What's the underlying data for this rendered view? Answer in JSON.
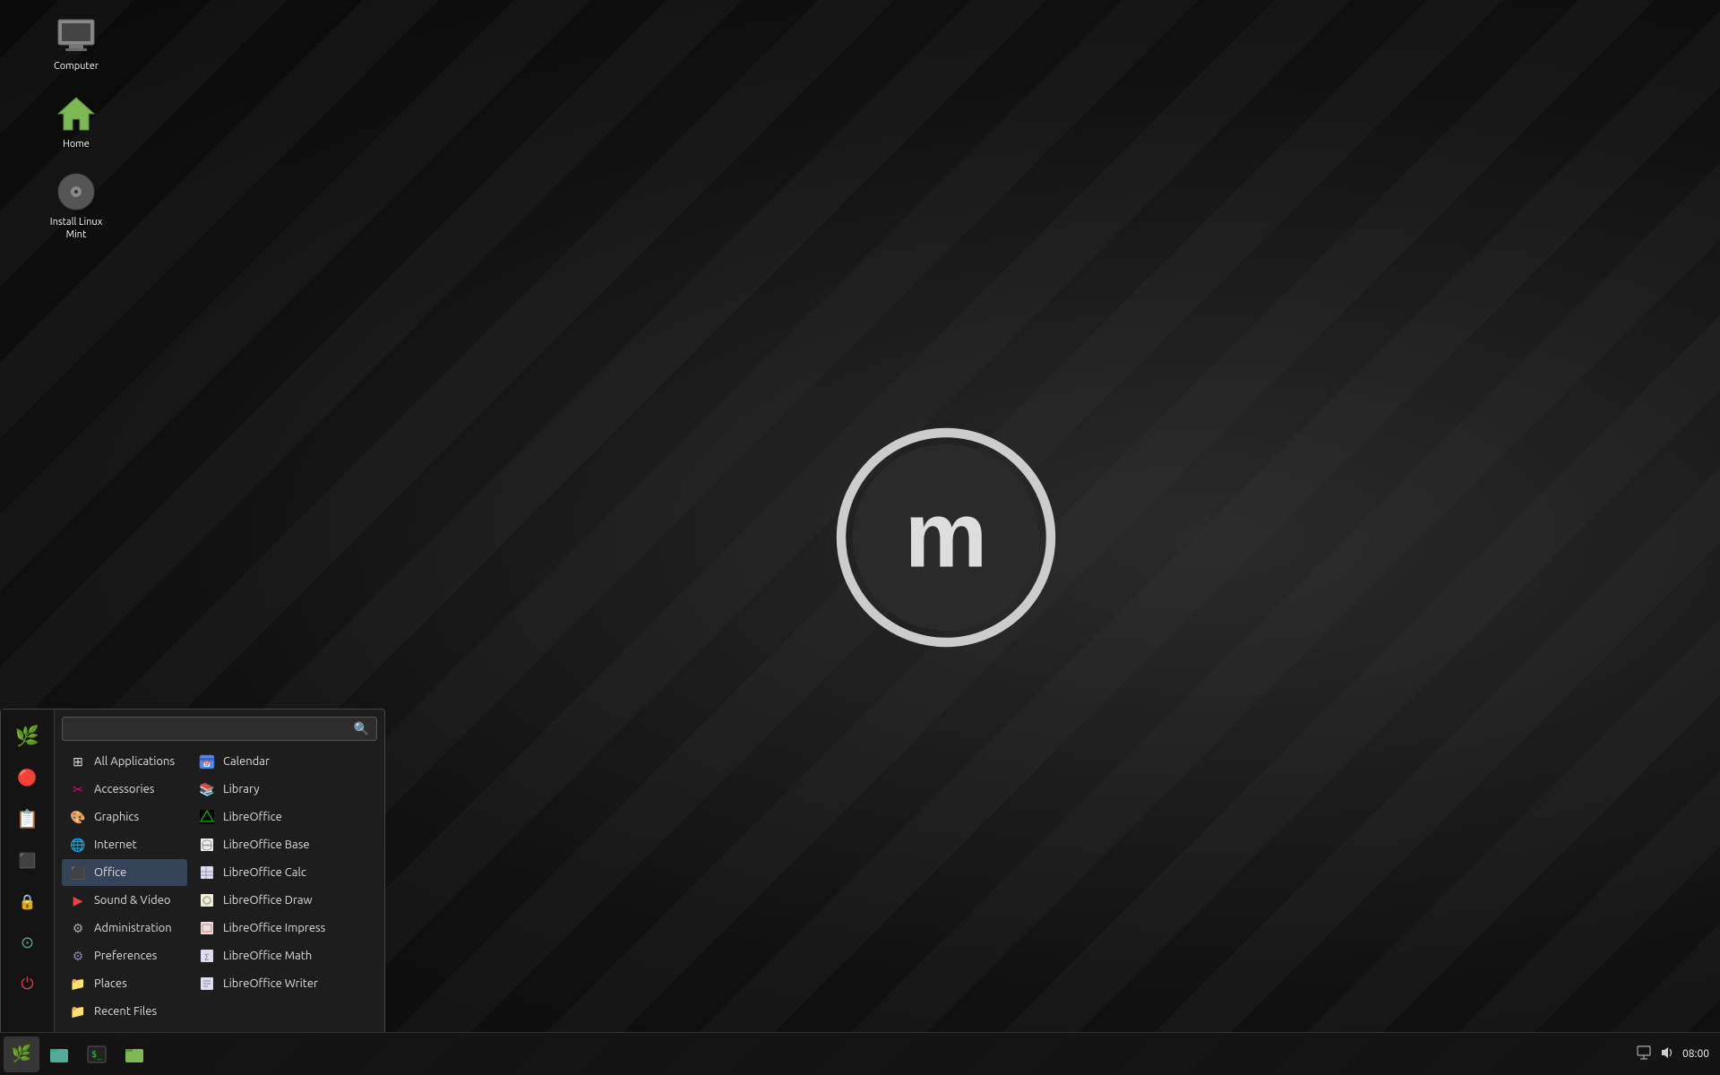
{
  "desktop": {
    "icons": [
      {
        "id": "computer",
        "label": "Computer",
        "icon": "computer"
      },
      {
        "id": "home",
        "label": "Home",
        "icon": "home"
      },
      {
        "id": "install",
        "label": "Install Linux Mint",
        "icon": "disc"
      }
    ]
  },
  "taskbar": {
    "clock": "08:00",
    "buttons": [
      {
        "id": "menu",
        "icon": "🌿",
        "active": true
      },
      {
        "id": "fileman",
        "icon": "📁",
        "active": false
      },
      {
        "id": "terminal",
        "icon": "⬛",
        "active": false
      },
      {
        "id": "files2",
        "icon": "📂",
        "active": false
      }
    ],
    "tray": {
      "network": "⊞",
      "volume": "🔊",
      "time": "08:00"
    }
  },
  "app_menu": {
    "search_placeholder": "",
    "sidebar_buttons": [
      {
        "id": "mintmenu",
        "icon": "🌿"
      },
      {
        "id": "apps",
        "icon": "⬛"
      },
      {
        "id": "files",
        "icon": "📋"
      },
      {
        "id": "terminal2",
        "icon": "⬛"
      },
      {
        "id": "lock",
        "icon": "🔒"
      },
      {
        "id": "search2",
        "icon": "⊙"
      },
      {
        "id": "power",
        "icon": "⏻"
      }
    ],
    "categories": [
      {
        "id": "all-applications",
        "label": "All Applications",
        "icon": "grid",
        "selected": false
      },
      {
        "id": "accessories",
        "label": "Accessories",
        "icon": "wrench",
        "selected": false
      },
      {
        "id": "graphics",
        "label": "Graphics",
        "icon": "graphics",
        "selected": false
      },
      {
        "id": "internet",
        "label": "Internet",
        "icon": "internet",
        "selected": false
      },
      {
        "id": "office",
        "label": "Office",
        "icon": "office",
        "selected": true
      },
      {
        "id": "sound-video",
        "label": "Sound & Video",
        "icon": "sound",
        "selected": false
      },
      {
        "id": "administration",
        "label": "Administration",
        "icon": "admin",
        "selected": false
      },
      {
        "id": "preferences",
        "label": "Preferences",
        "icon": "prefs",
        "selected": false
      },
      {
        "id": "places",
        "label": "Places",
        "icon": "places",
        "selected": false
      },
      {
        "id": "recent-files",
        "label": "Recent Files",
        "icon": "recent",
        "selected": false
      }
    ],
    "apps": [
      {
        "id": "calendar",
        "label": "Calendar",
        "icon": "cal"
      },
      {
        "id": "library",
        "label": "Library",
        "icon": "lib"
      },
      {
        "id": "libreoffice",
        "label": "LibreOffice",
        "icon": "lo"
      },
      {
        "id": "libreoffice-base",
        "label": "LibreOffice Base",
        "icon": "lobase"
      },
      {
        "id": "libreoffice-calc",
        "label": "LibreOffice Calc",
        "icon": "localc"
      },
      {
        "id": "libreoffice-draw",
        "label": "LibreOffice Draw",
        "icon": "lodraw"
      },
      {
        "id": "libreoffice-impress",
        "label": "LibreOffice Impress",
        "icon": "loimpress"
      },
      {
        "id": "libreoffice-math",
        "label": "LibreOffice Math",
        "icon": "lomath"
      },
      {
        "id": "libreoffice-writer",
        "label": "LibreOffice Writer",
        "icon": "lowriter"
      }
    ]
  }
}
